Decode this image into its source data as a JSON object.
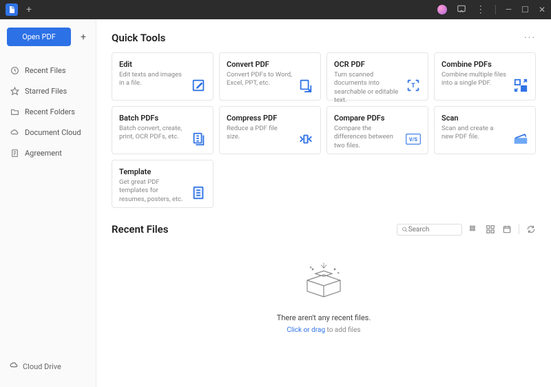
{
  "titlebar": {
    "new_tab": "+",
    "window": {
      "min": "—",
      "max": "☐",
      "close": "✕"
    }
  },
  "sidebar": {
    "open_label": "Open PDF",
    "items": [
      {
        "icon": "clock-icon",
        "label": "Recent Files"
      },
      {
        "icon": "star-icon",
        "label": "Starred Files"
      },
      {
        "icon": "folder-icon",
        "label": "Recent Folders"
      },
      {
        "icon": "cloud-icon",
        "label": "Document Cloud"
      },
      {
        "icon": "file-icon",
        "label": "Agreement"
      }
    ],
    "bottom": {
      "label": "Cloud Drive"
    }
  },
  "quick_tools": {
    "heading": "Quick Tools",
    "more": "···",
    "cards": [
      {
        "title": "Edit",
        "desc": "Edit texts and images in a file.",
        "icon": "edit-icon"
      },
      {
        "title": "Convert PDF",
        "desc": "Convert PDFs to Word, Excel, PPT, etc.",
        "icon": "convert-icon"
      },
      {
        "title": "OCR PDF",
        "desc": "Turn scanned documents into searchable or editable text.",
        "icon": "ocr-icon"
      },
      {
        "title": "Combine PDFs",
        "desc": "Combine multiple files into a single PDF.",
        "icon": "combine-icon"
      },
      {
        "title": "Batch PDFs",
        "desc": "Batch convert, create, print, OCR PDFs, etc.",
        "icon": "batch-icon"
      },
      {
        "title": "Compress PDF",
        "desc": "Reduce a PDF file size.",
        "icon": "compress-icon"
      },
      {
        "title": "Compare PDFs",
        "desc": "Compare the differences between two files.",
        "icon": "compare-icon"
      },
      {
        "title": "Scan",
        "desc": "Scan and create a new PDF file.",
        "icon": "scan-icon"
      },
      {
        "title": "Template",
        "desc": "Get great PDF templates for resumes, posters, etc.",
        "icon": "template-icon"
      }
    ]
  },
  "recent": {
    "heading": "Recent Files",
    "search_placeholder": "Search",
    "empty_msg": "There aren't any recent files.",
    "hint_prefix": "Click or drag",
    "hint_suffix": " to add files"
  }
}
